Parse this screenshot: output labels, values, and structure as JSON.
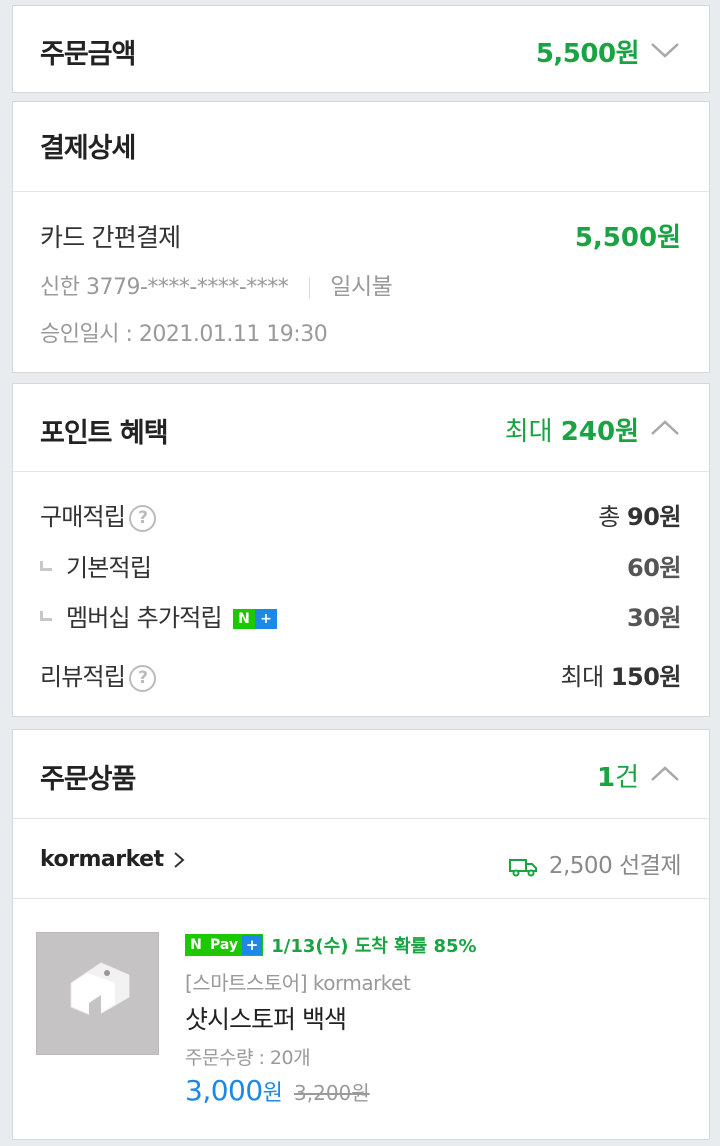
{
  "order_amount": {
    "title": "주문금액",
    "amount": "5,500원"
  },
  "payment_detail": {
    "title": "결제상세",
    "method": "카드 간편결제",
    "amount": "5,500원",
    "card": "신한 3779-****-****-****",
    "installment": "일시불",
    "approved": "승인일시 : 2021.01.11 19:30"
  },
  "points": {
    "title": "포인트 혜택",
    "max_prefix": "최대",
    "max_amount": "240원",
    "items": [
      {
        "label": "구매적립",
        "value_prefix": "총",
        "value": "90원"
      },
      {
        "label": "기본적립",
        "value": "60원"
      },
      {
        "label": "멤버십 추가적립",
        "value": "30원"
      },
      {
        "label": "리뷰적립",
        "value_prefix": "최대",
        "value": "150원"
      }
    ],
    "help_glyph": "?",
    "nplus_n": "N",
    "nplus_plus": "+"
  },
  "order_products": {
    "title": "주문상품",
    "count_num": "1",
    "count_unit": "건",
    "store": "kormarket",
    "shipping": "2,500 선결제",
    "product": {
      "pay_n": "N",
      "pay_text": "Pay",
      "pay_plus": "+",
      "arrival": "1/13(수) 도착 확률 85%",
      "store_label": "[스마트스토어] kormarket",
      "name": "샷시스토퍼 백색",
      "quantity": "주문수량 : 20개",
      "price_num": "3,000",
      "price_unit": "원",
      "original_price": "3,200원"
    }
  },
  "colors": {
    "accent_green": "#1aa343",
    "price_blue": "#1e88e5",
    "npay_green": "#1ec800"
  }
}
